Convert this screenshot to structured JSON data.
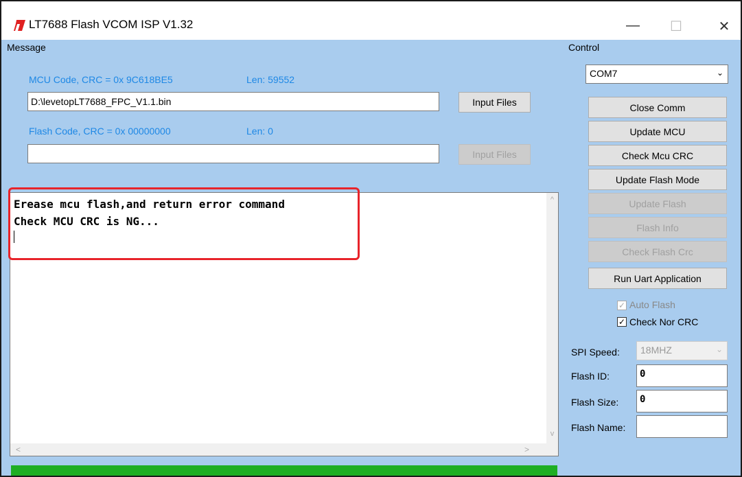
{
  "window": {
    "title": "LT7688 Flash VCOM ISP V1.32",
    "minimize": "—",
    "maximize": "☐",
    "close": "✕"
  },
  "message_group": {
    "label": "Message",
    "mcu_code": "MCU Code, CRC = 0x 9C618BE5",
    "mcu_len": "Len:  59552",
    "mcu_file": "D:\\levetopLT7688_FPC_V1.1.bin",
    "input_files_1": "Input Files",
    "flash_code": "Flash Code, CRC = 0x 00000000",
    "flash_len": "Len:  0",
    "flash_file": "",
    "input_files_2": "Input Files"
  },
  "log": {
    "line1": "Erease mcu flash,and return error command",
    "line2": "Check MCU CRC is NG...",
    "scroll_up": "^",
    "scroll_down": "v",
    "scroll_left": "<",
    "scroll_right": ">"
  },
  "control_group": {
    "label": "Control",
    "com_port": "COM7",
    "close_comm": "Close Comm",
    "update_mcu": "Update MCU",
    "check_mcu_crc": "Check Mcu CRC",
    "update_flash_mode": "Update Flash Mode",
    "update_flash": "Update Flash",
    "flash_info": "Flash Info",
    "check_flash_crc": "Check Flash Crc",
    "run_uart": "Run Uart Application",
    "auto_flash": "Auto Flash",
    "check_nor_crc": "Check Nor CRC",
    "spi_speed_label": "SPI Speed:",
    "spi_speed_value": "18MHZ",
    "flash_id_label": "Flash ID:",
    "flash_id_value": "0",
    "flash_size_label": "Flash Size:",
    "flash_size_value": "0",
    "flash_name_label": "Flash Name:",
    "flash_name_value": ""
  },
  "colors": {
    "panel": "#a9ccee",
    "highlight": "#e8242a",
    "progress": "#1fae23",
    "blue_text": "#1e88e5"
  }
}
